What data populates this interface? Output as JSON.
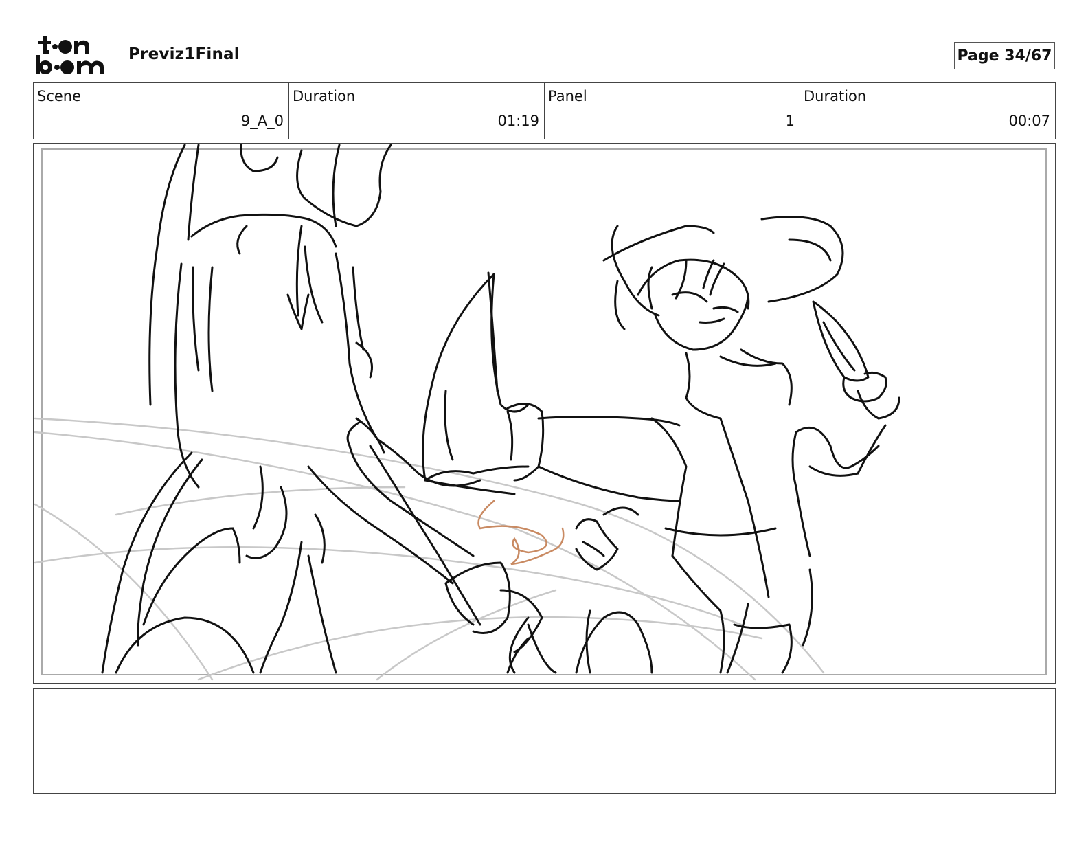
{
  "header": {
    "logo_icon": "toonboom-logo",
    "project_title": "Previz1Final",
    "page_label": "Page 34/67"
  },
  "info": {
    "scene_label": "Scene",
    "scene_value": "9_A_0",
    "scene_duration_label": "Duration",
    "scene_duration_value": "01:19",
    "panel_label": "Panel",
    "panel_value": "1",
    "panel_duration_label": "Duration",
    "panel_duration_value": "00:07"
  },
  "panel": {
    "image_icon": "storyboard-sketch-image",
    "colors": {
      "ink": "#111111",
      "guide": "#c8c8c8",
      "fx": "#c98a62",
      "safe_frame": "#aaaaaa"
    }
  },
  "notes": {
    "text": ""
  }
}
